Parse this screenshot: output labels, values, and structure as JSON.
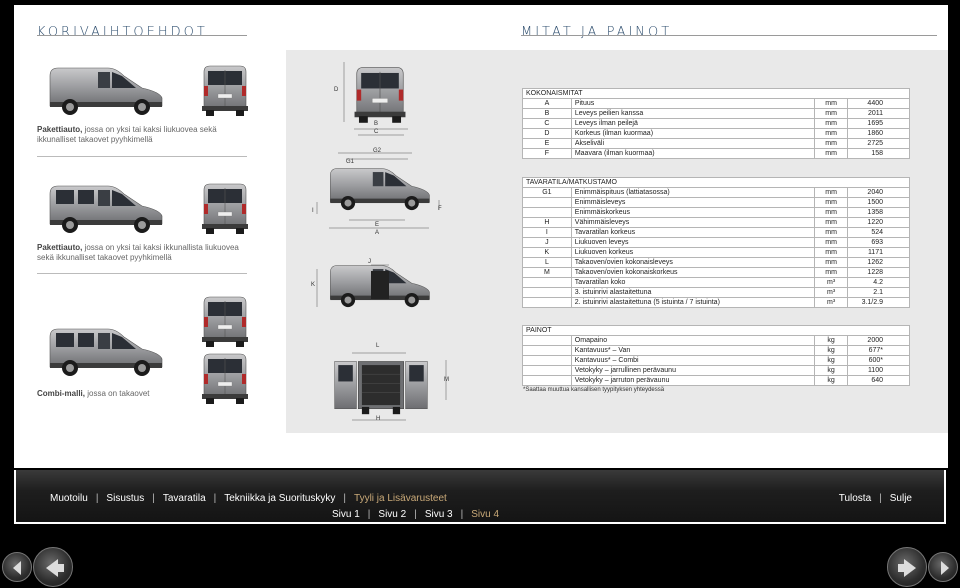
{
  "left_title": "KORIVAIHTOEHDOT",
  "right_title": "MITAT JA PAINOT",
  "variants": [
    {
      "bold": "Pakettiauto,",
      "rest": "jossa on yksi tai kaksi liukuovea sekä ikkunalliset takaovet pyyhkimellä"
    },
    {
      "bold": "Pakettiauto,",
      "rest": "jossa on yksi tai kaksi ikkunallista liukuovea sekä ikkunalliset takaovet pyyhkimellä"
    },
    {
      "bold": "Combi-malli,",
      "rest": "jossa on takaovet"
    }
  ],
  "dim_labels": {
    "D": "D",
    "B": "B",
    "C": "C",
    "G2": "G2",
    "G1": "G1",
    "I": "I",
    "E": "E",
    "A": "A",
    "F": "F",
    "J": "J",
    "K": "K",
    "L": "L",
    "M": "M",
    "H": "H"
  },
  "tables": {
    "kokonaismitat": {
      "header": "KOKONAISMITAT",
      "rows": [
        [
          "A",
          "Pituus",
          "mm",
          "4400"
        ],
        [
          "B",
          "Leveys peilien kanssa",
          "mm",
          "2011"
        ],
        [
          "C",
          "Leveys ilman peilejä",
          "mm",
          "1695"
        ],
        [
          "D",
          "Korkeus (ilman kuormaa)",
          "mm",
          "1860"
        ],
        [
          "E",
          "Akseliväli",
          "mm",
          "2725"
        ],
        [
          "F",
          "Maavara (ilman kuormaa)",
          "mm",
          "158"
        ]
      ]
    },
    "tavaratila": {
      "header": "TAVARATILA/MATKUSTAMO",
      "rows": [
        [
          "G1",
          "Enimmäispituus (lattiatasossa)",
          "mm",
          "2040"
        ],
        [
          "",
          "Enimmäisleveys",
          "mm",
          "1500"
        ],
        [
          "",
          "Enimmäiskorkeus",
          "mm",
          "1358"
        ],
        [
          "H",
          "Vähimmäisleveys",
          "mm",
          "1220"
        ],
        [
          "I",
          "Tavaratilan korkeus",
          "mm",
          "524"
        ],
        [
          "J",
          "Liukuoven leveys",
          "mm",
          "693"
        ],
        [
          "K",
          "Liukuoven korkeus",
          "mm",
          "1171"
        ],
        [
          "L",
          "Takaoven/ovien kokonaisleveys",
          "mm",
          "1262"
        ],
        [
          "M",
          "Takaoven/ovien kokonaiskorkeus",
          "mm",
          "1228"
        ],
        [
          "",
          "Tavaratilan koko",
          "m³",
          "4.2"
        ],
        [
          "",
          "3. istuinrivi alastaitettuna",
          "m³",
          "2.1"
        ],
        [
          "",
          "2. istuinrivi alastaitettuna (5 istuinta / 7 istuinta)",
          "m³",
          "3.1/2.9"
        ]
      ]
    },
    "painot": {
      "header": "PAINOT",
      "rows": [
        [
          "",
          "Omapaino",
          "kg",
          "2000"
        ],
        [
          "",
          "Kantavuus* – Van",
          "kg",
          "677*"
        ],
        [
          "",
          "Kantavuus* – Combi",
          "kg",
          "600*"
        ],
        [
          "",
          "Vetokyky – jarrullinen perävaunu",
          "kg",
          "1100"
        ],
        [
          "",
          "Vetokyky – jarruton perävaunu",
          "kg",
          "640"
        ]
      ]
    }
  },
  "footnote": "*Saattaa muuttua kansallisen tyypityksen yhteydessä",
  "nav": {
    "main": [
      "Muotoilu",
      "Sisustus",
      "Tavaratila",
      "Tekniikka ja Suorituskyky",
      "Tyyli ja Lisävarusteet"
    ],
    "pages": [
      "Sivu 1",
      "Sivu 2",
      "Sivu 3",
      "Sivu 4"
    ],
    "right": [
      "Tulosta",
      "Sulje"
    ],
    "separator": "|"
  },
  "colors": {
    "accent": "#c9a978",
    "title": "#2f4f6f",
    "panel": "#e9e9e9"
  },
  "icons": {
    "prev": "arrow-left-icon",
    "next": "arrow-right-icon"
  }
}
